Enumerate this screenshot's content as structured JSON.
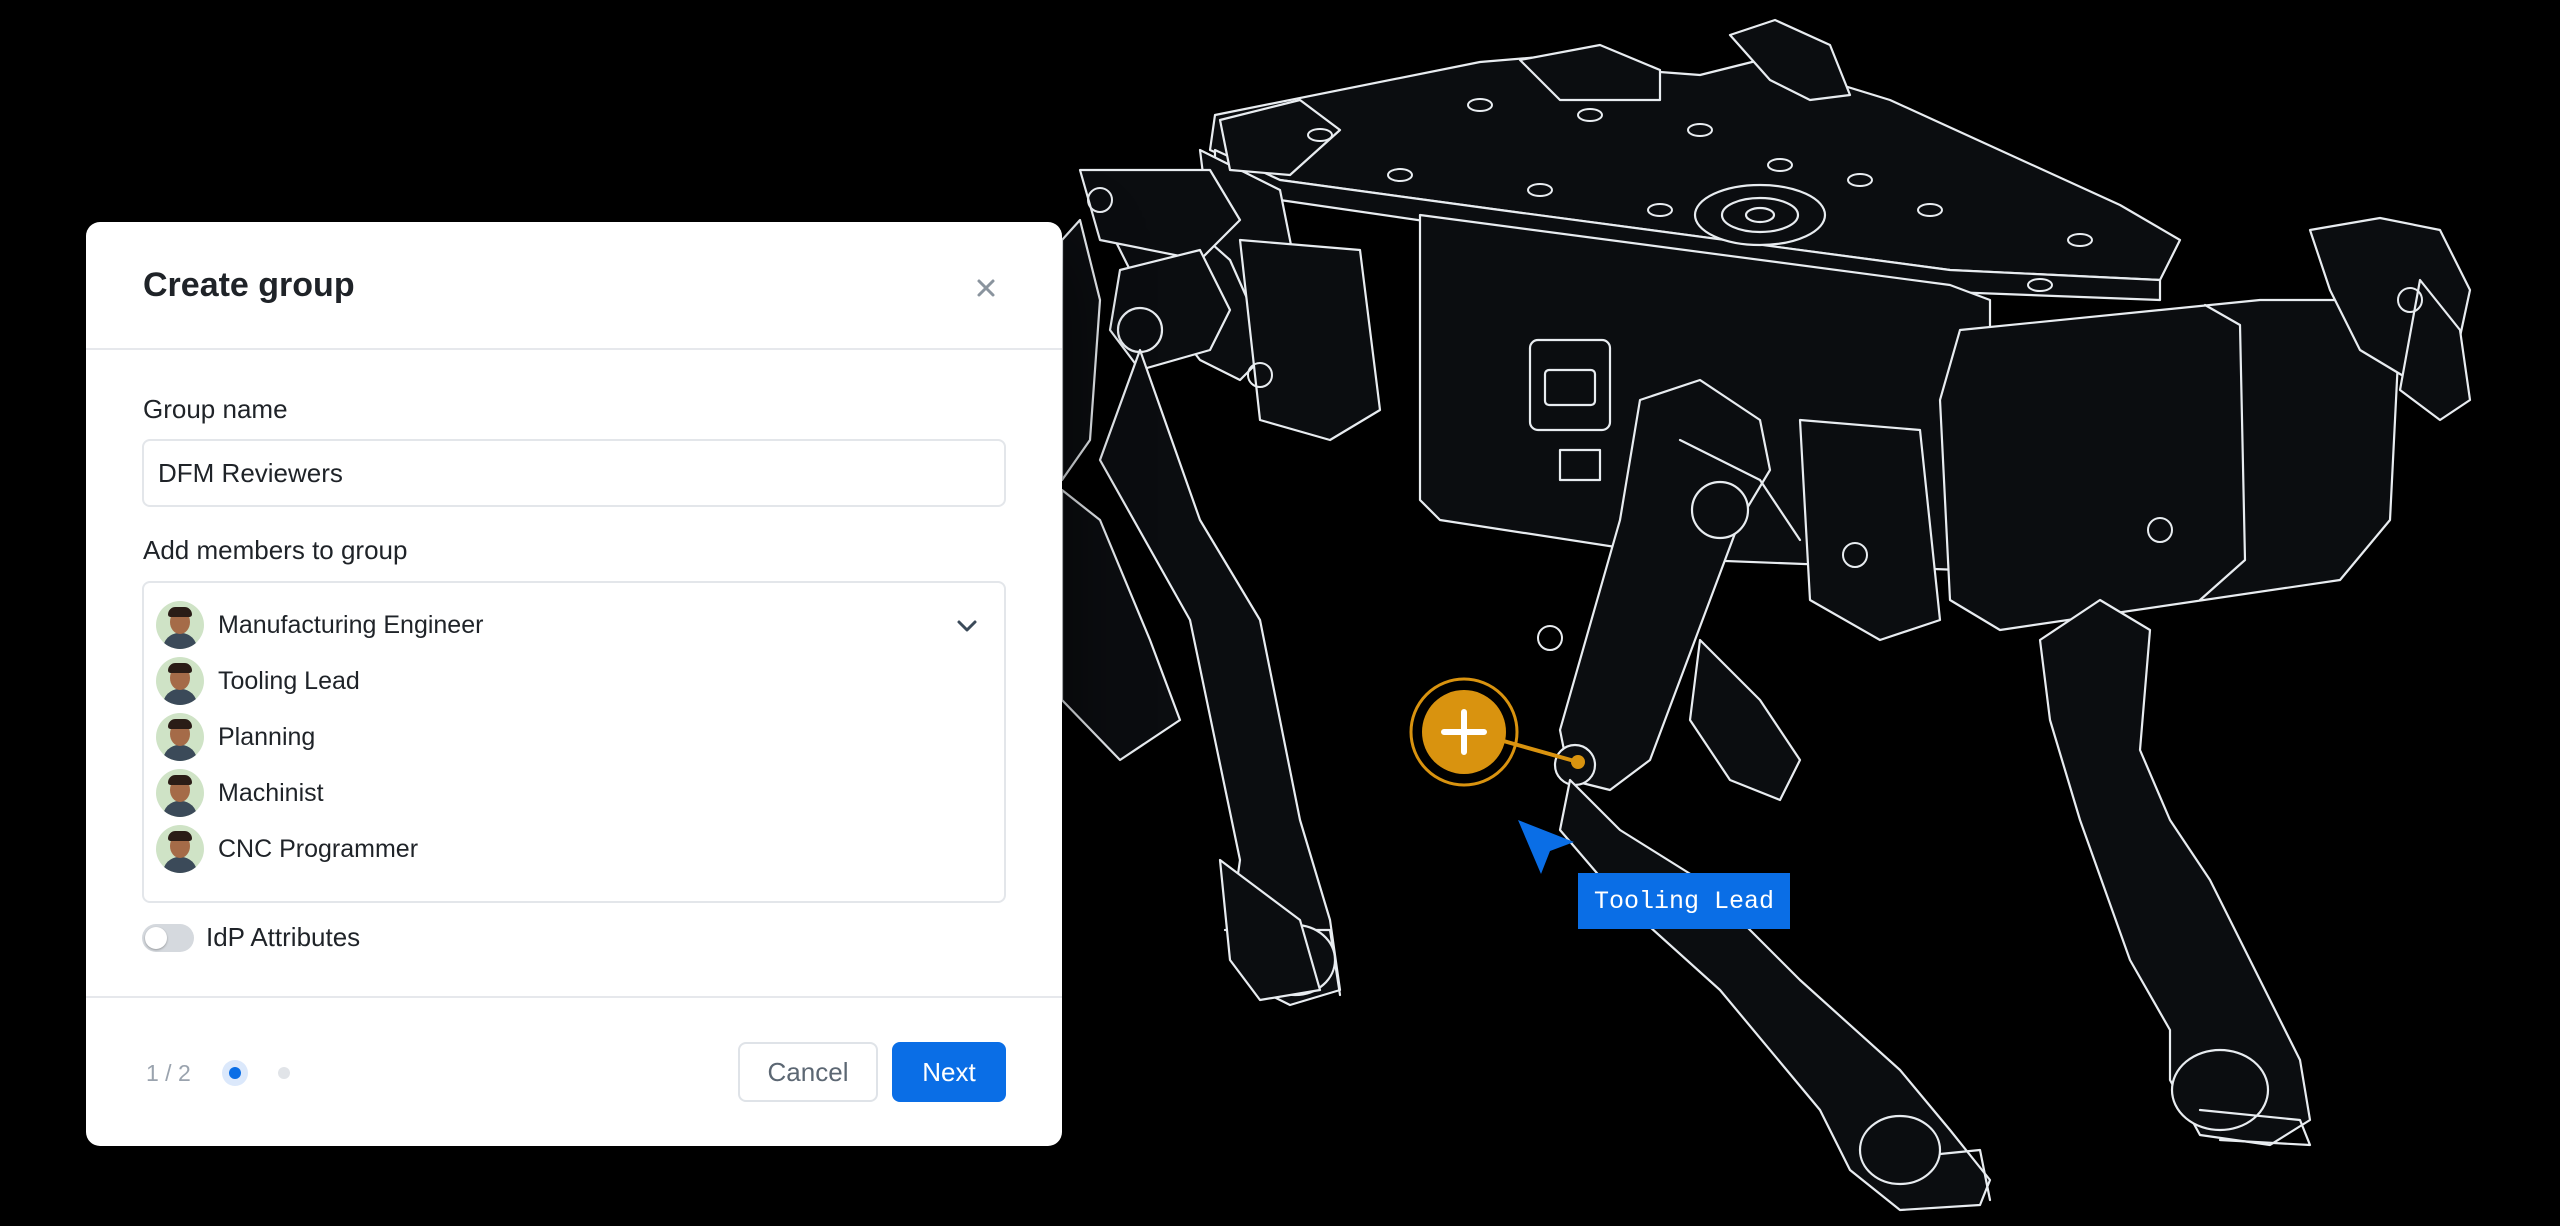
{
  "modal": {
    "title": "Create group",
    "close_icon": "close-icon",
    "group_name_label": "Group name",
    "group_name_value": "DFM Reviewers",
    "members_label": "Add members to group",
    "members": [
      {
        "name": "Manufacturing Engineer"
      },
      {
        "name": "Tooling Lead"
      },
      {
        "name": "Planning"
      },
      {
        "name": "Machinist"
      },
      {
        "name": "CNC Programmer"
      }
    ],
    "idp_label": "IdP Attributes",
    "idp_enabled": false,
    "page_indicator": "1 / 2",
    "current_step": 1,
    "total_steps": 2,
    "cancel_label": "Cancel",
    "next_label": "Next"
  },
  "annotation": {
    "tag_label": "Tooling Lead",
    "add_icon": "plus-icon",
    "cursor_icon": "cursor-arrow-icon"
  },
  "colors": {
    "accent_blue": "#0a6ee6",
    "marker_orange": "#d9930f",
    "background": "#000000",
    "wireframe": "#e8ecf0"
  }
}
